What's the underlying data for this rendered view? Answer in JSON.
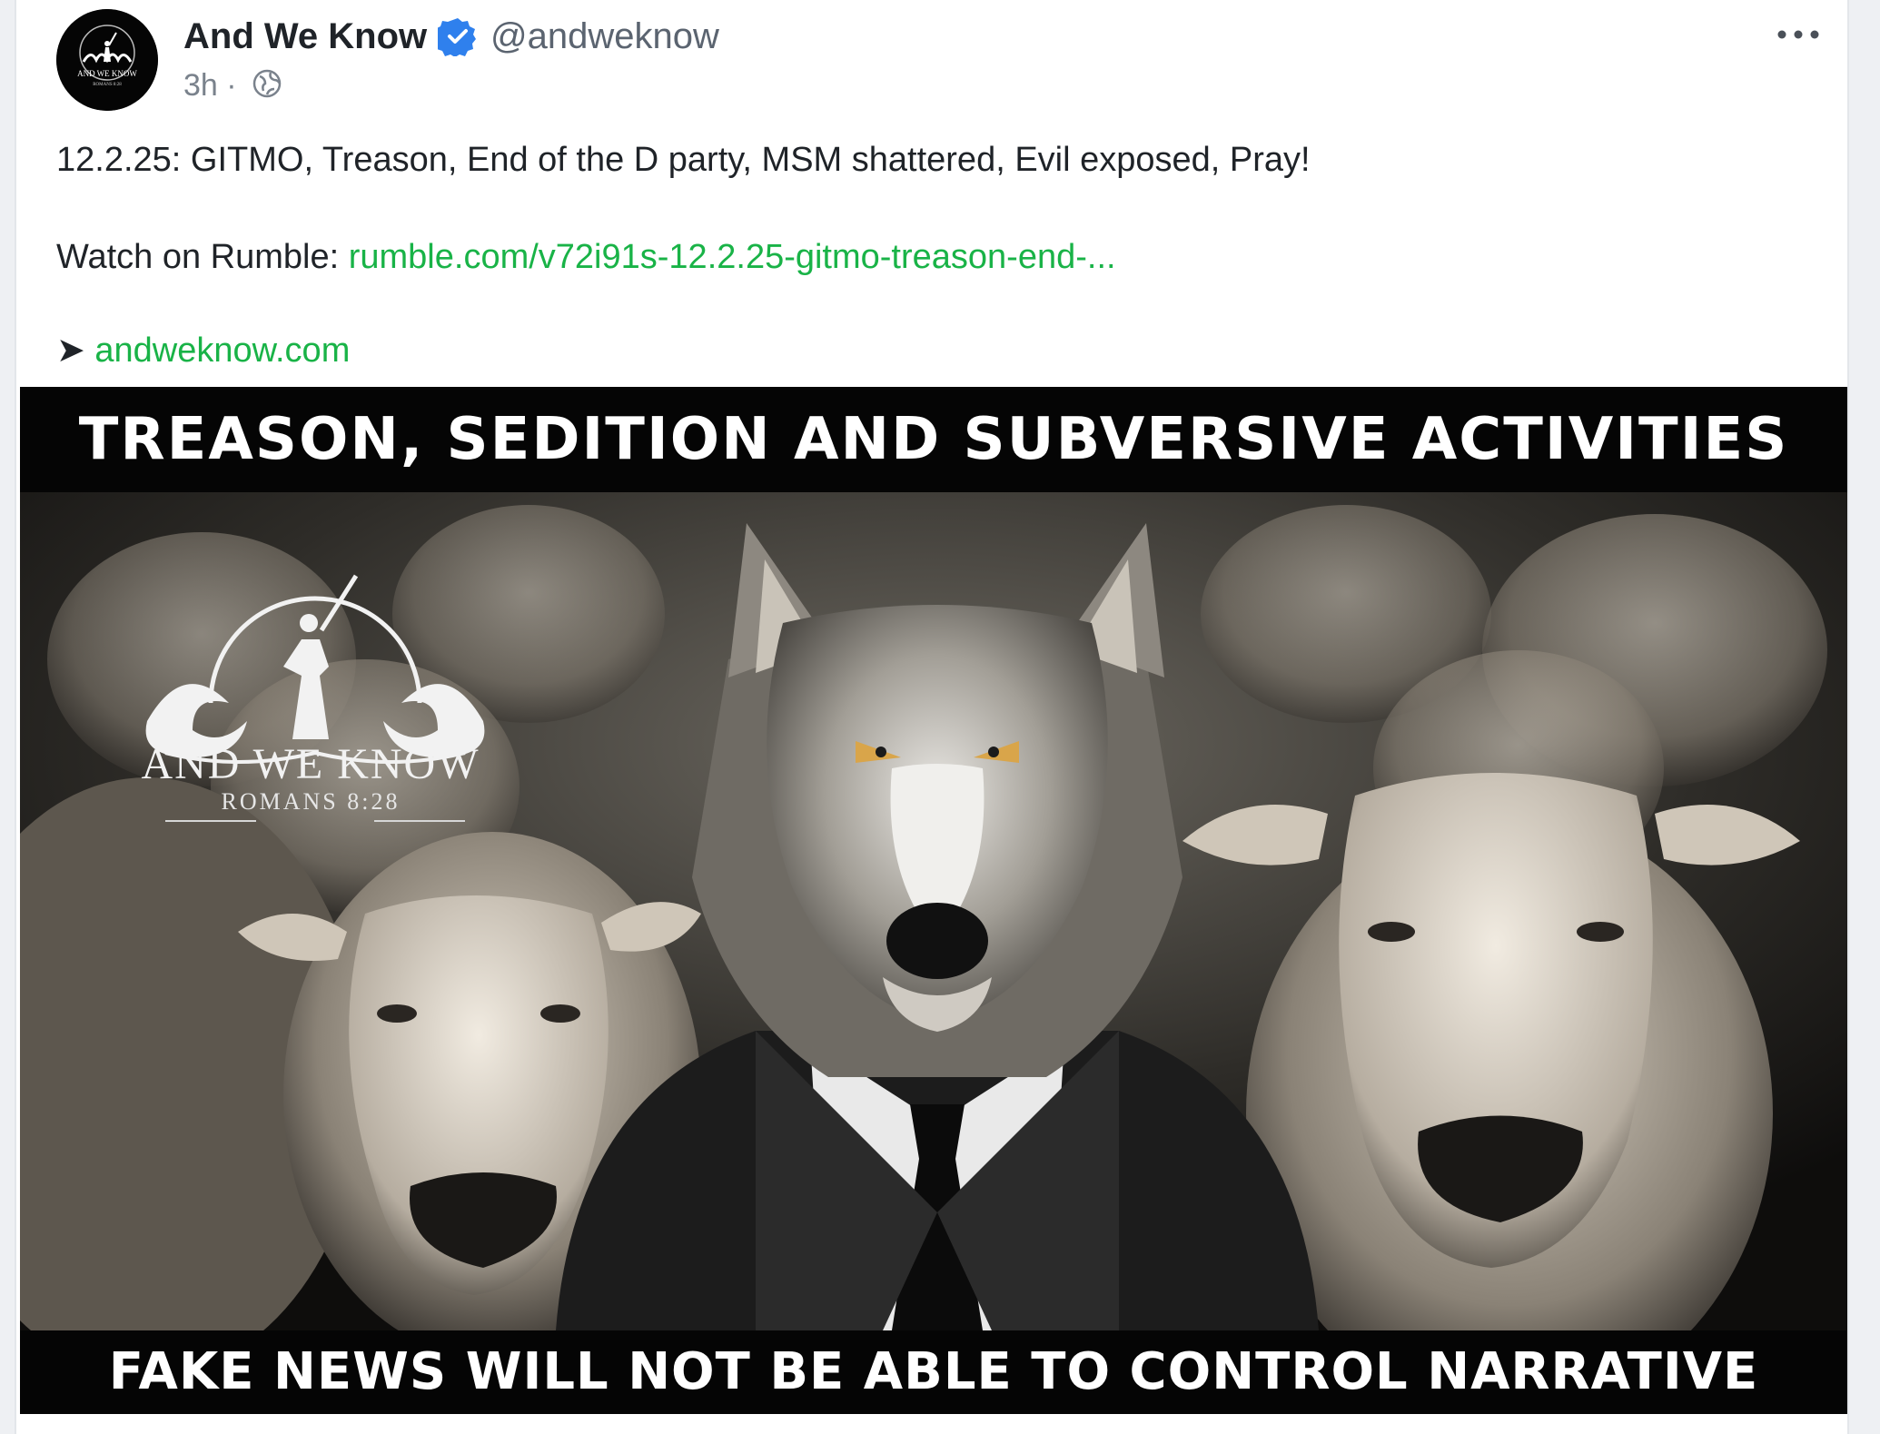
{
  "author": {
    "name": "And We Know",
    "handle": "@andweknow",
    "verified": true,
    "avatar_text_top": "AND WE KNOW",
    "avatar_text_bottom": "ROMANS 8:28"
  },
  "meta": {
    "time": "3h",
    "separator": "·",
    "visibility_icon": "globe-icon"
  },
  "post": {
    "text": "12.2.25: GITMO, Treason, End of the D party, MSM shattered, Evil exposed, Pray!",
    "watch_prefix": "Watch on Rumble: ",
    "watch_link": "rumble.com/v72i91s-12.2.25-gitmo-treason-end-...",
    "arrow": "➤ ",
    "site_link": "andweknow.com"
  },
  "media": {
    "top_banner": "TREASON, SEDITION AND SUBVERSIVE ACTIVITIES",
    "bottom_banner": "FAKE NEWS WILL NOT BE ABLE TO CONTROL NARRATIVE",
    "logo_title": "AND WE KNOW",
    "logo_sub": "ROMANS 8:28"
  },
  "colors": {
    "link": "#19b347",
    "verified": "#2f80ed",
    "text": "#1f2328",
    "muted": "#7a828c"
  }
}
